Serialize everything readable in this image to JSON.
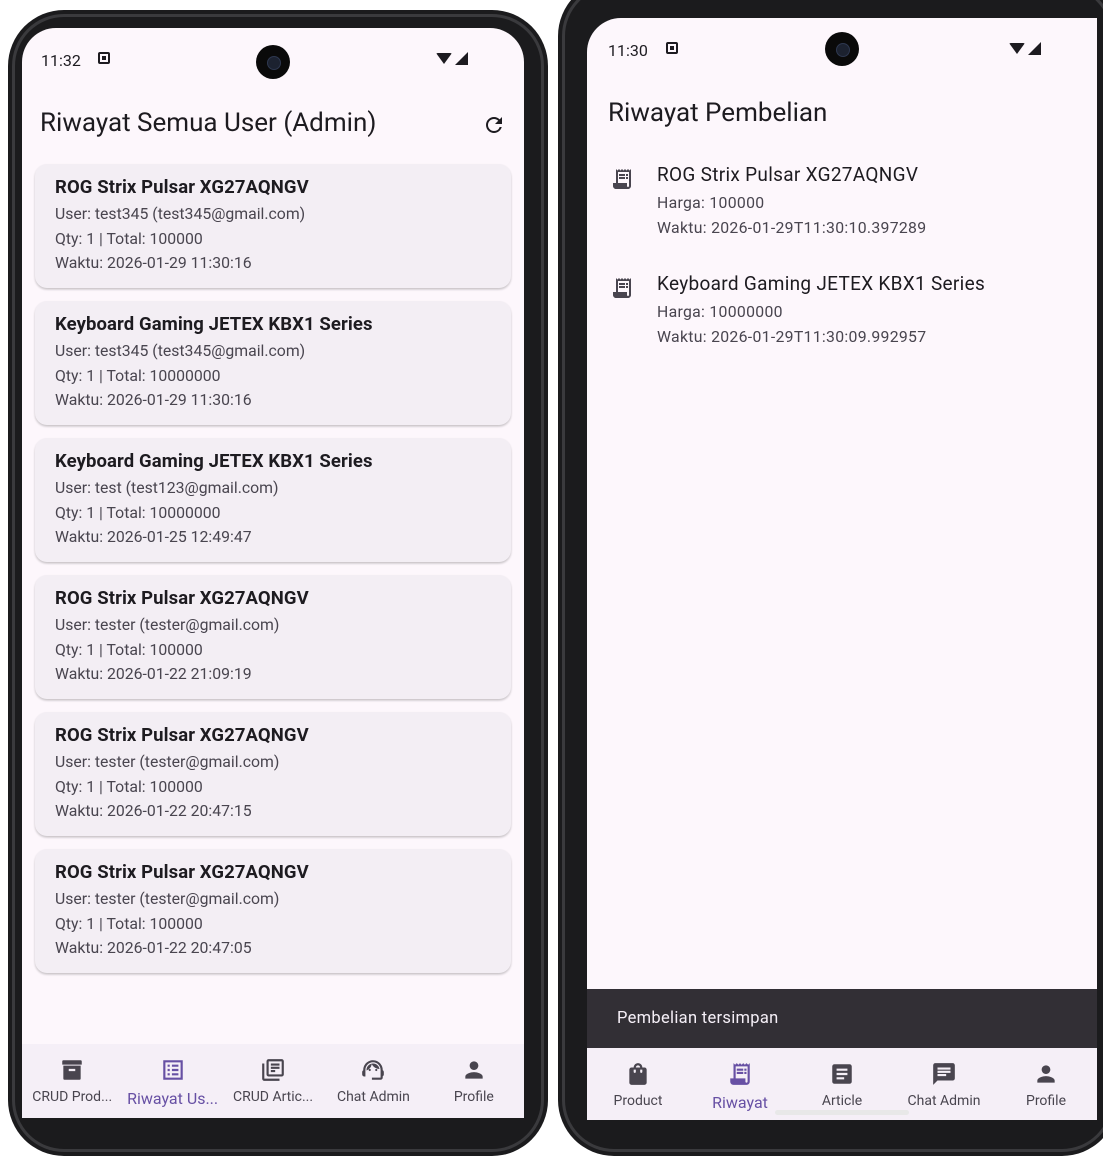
{
  "left": {
    "status": {
      "time": "11:32"
    },
    "title": "Riwayat Semua User (Admin)",
    "cards": [
      {
        "product": "ROG Strix Pulsar XG27AQNGV",
        "user": "User: test345 (test345@gmail.com)",
        "qty": "Qty: 1 | Total: 100000",
        "time": "Waktu: 2026-01-29 11:30:16"
      },
      {
        "product": "Keyboard Gaming JETEX KBX1 Series",
        "user": "User: test345 (test345@gmail.com)",
        "qty": "Qty: 1 | Total: 10000000",
        "time": "Waktu: 2026-01-29 11:30:16"
      },
      {
        "product": "Keyboard Gaming JETEX KBX1 Series",
        "user": "User: test (test123@gmail.com)",
        "qty": "Qty: 1 | Total: 10000000",
        "time": "Waktu: 2026-01-25 12:49:47"
      },
      {
        "product": "ROG Strix Pulsar XG27AQNGV",
        "user": "User: tester (tester@gmail.com)",
        "qty": "Qty: 1 | Total: 100000",
        "time": "Waktu: 2026-01-22 21:09:19"
      },
      {
        "product": "ROG Strix Pulsar XG27AQNGV",
        "user": "User: tester (tester@gmail.com)",
        "qty": "Qty: 1 | Total: 100000",
        "time": "Waktu: 2026-01-22 20:47:15"
      },
      {
        "product": "ROG Strix Pulsar XG27AQNGV",
        "user": "User: tester (tester@gmail.com)",
        "qty": "Qty: 1 | Total: 100000",
        "time": "Waktu: 2026-01-22 20:47:05"
      }
    ],
    "nav": [
      {
        "label": "CRUD Prod...",
        "icon": "archive-icon"
      },
      {
        "label": "Riwayat Us...",
        "icon": "list-icon",
        "active": true
      },
      {
        "label": "CRUD Artic...",
        "icon": "library-icon"
      },
      {
        "label": "Chat Admin",
        "icon": "support-agent-icon"
      },
      {
        "label": "Profile",
        "icon": "person-icon"
      }
    ]
  },
  "right": {
    "status": {
      "time": "11:30"
    },
    "title": "Riwayat Pembelian",
    "items": [
      {
        "product": "ROG Strix Pulsar XG27AQNGV",
        "price": "Harga: 100000",
        "time": "Waktu: 2026-01-29T11:30:10.397289"
      },
      {
        "product": "Keyboard Gaming JETEX KBX1 Series",
        "price": "Harga: 10000000",
        "time": "Waktu: 2026-01-29T11:30:09.992957"
      }
    ],
    "snackbar": "Pembelian tersimpan",
    "nav": [
      {
        "label": "Product",
        "icon": "shopping-bag-icon"
      },
      {
        "label": "Riwayat",
        "icon": "receipt-icon",
        "active": true
      },
      {
        "label": "Article",
        "icon": "article-icon"
      },
      {
        "label": "Chat Admin",
        "icon": "chat-icon"
      },
      {
        "label": "Profile",
        "icon": "person-icon"
      }
    ]
  },
  "colors": {
    "accent": "#6750a4",
    "surface": "#fdf7fc",
    "card": "#f3eef4",
    "text": "#1d1b20",
    "muted": "#49454f",
    "snackbar": "#322f35"
  }
}
